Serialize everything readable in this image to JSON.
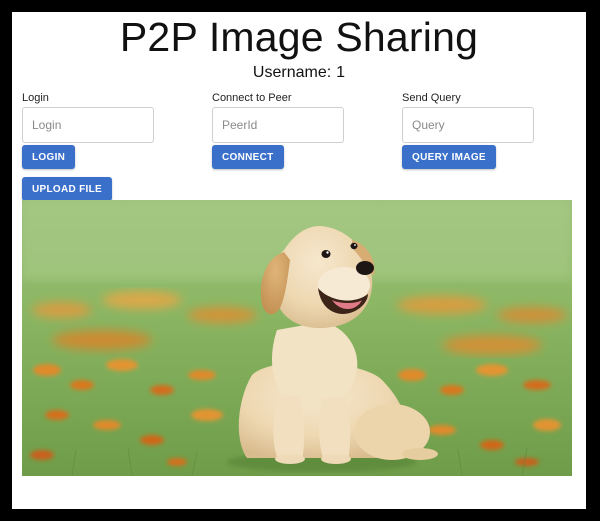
{
  "app": {
    "title": "P2P Image Sharing"
  },
  "user": {
    "username_label": "Username:",
    "username_value": "1"
  },
  "login": {
    "label": "Login",
    "placeholder": "Login",
    "button_label": "LOGIN"
  },
  "peer": {
    "label": "Connect to Peer",
    "placeholder": "PeerId",
    "button_label": "CONNECT"
  },
  "query": {
    "label": "Send Query",
    "placeholder": "Query",
    "button_label": "QUERY IMAGE"
  },
  "upload": {
    "button_label": "UPLOAD FILE"
  },
  "image": {
    "subject": "golden retriever puppy sitting in a grassy field with orange flowers"
  },
  "colors": {
    "primary_button": "#3a6fca",
    "page_background": "#ffffff",
    "frame": "#000000"
  }
}
